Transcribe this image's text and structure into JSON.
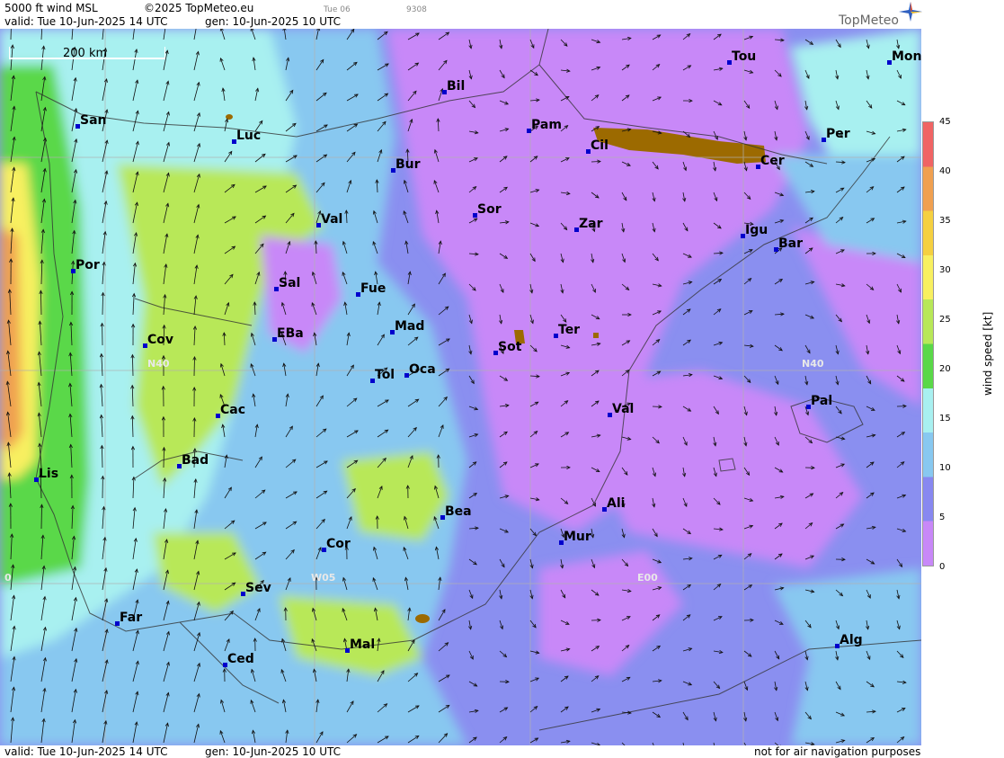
{
  "header": {
    "product": "5000 ft wind MSL",
    "copyright": "©2025 TopMeteo.eu",
    "run_label": "Tue 06",
    "code": "9308",
    "valid": "valid:  Tue  10-Jun-2025  14 UTC",
    "generated": "gen: 10-Jun-2025 10 UTC"
  },
  "footer": {
    "valid": "valid:  Tue  10-Jun-2025  14 UTC",
    "generated": "gen: 10-Jun-2025 10 UTC",
    "disclaimer": "not for air navigation purposes"
  },
  "logo": {
    "text": "TopMeteo",
    "icon": "compass-star-icon"
  },
  "scale_bar": {
    "label": "200 km"
  },
  "grid_labels": {
    "n40_west": "N40",
    "n40_east": "N40",
    "w05": "W05",
    "e00": "E00",
    "zero": "0"
  },
  "cities": [
    {
      "name": "Tou"
    },
    {
      "name": "Mon"
    },
    {
      "name": "Bil"
    },
    {
      "name": "San"
    },
    {
      "name": "Pam"
    },
    {
      "name": "Luc"
    },
    {
      "name": "Per"
    },
    {
      "name": "Cil"
    },
    {
      "name": "Cer"
    },
    {
      "name": "Bur"
    },
    {
      "name": "Sor"
    },
    {
      "name": "Val"
    },
    {
      "name": "Zar"
    },
    {
      "name": "Igu"
    },
    {
      "name": "Bar"
    },
    {
      "name": "Por"
    },
    {
      "name": "Sal"
    },
    {
      "name": "Fue"
    },
    {
      "name": "Mad"
    },
    {
      "name": "Cov"
    },
    {
      "name": "EBa"
    },
    {
      "name": "Ter"
    },
    {
      "name": "Sot"
    },
    {
      "name": "Tol"
    },
    {
      "name": "Oca"
    },
    {
      "name": "Pal"
    },
    {
      "name": "Cac"
    },
    {
      "name": "Val"
    },
    {
      "name": "Bad"
    },
    {
      "name": "Lis"
    },
    {
      "name": "Ali"
    },
    {
      "name": "Bea"
    },
    {
      "name": "Mur"
    },
    {
      "name": "Cor"
    },
    {
      "name": "Sev"
    },
    {
      "name": "Far"
    },
    {
      "name": "Alg"
    },
    {
      "name": "Mal"
    },
    {
      "name": "Ced"
    }
  ],
  "legend": {
    "title": "wind  speed  [kt]",
    "ticks": [
      "45",
      "40",
      "35",
      "30",
      "25",
      "20",
      "15",
      "10",
      "5",
      "0"
    ],
    "colors": [
      "#f06464",
      "#f0a050",
      "#f5d040",
      "#f8f060",
      "#b8e858",
      "#5ad848",
      "#a8f0f0",
      "#88c8f0",
      "#8888f0",
      "#c888f8"
    ]
  },
  "colors": {
    "calm": "#c888f8",
    "light": "#8a8ff0",
    "moderate": "#88c8f0",
    "fresh": "#a8f0f0",
    "strong": "#5ad848",
    "terrain": "#9c6a00"
  }
}
